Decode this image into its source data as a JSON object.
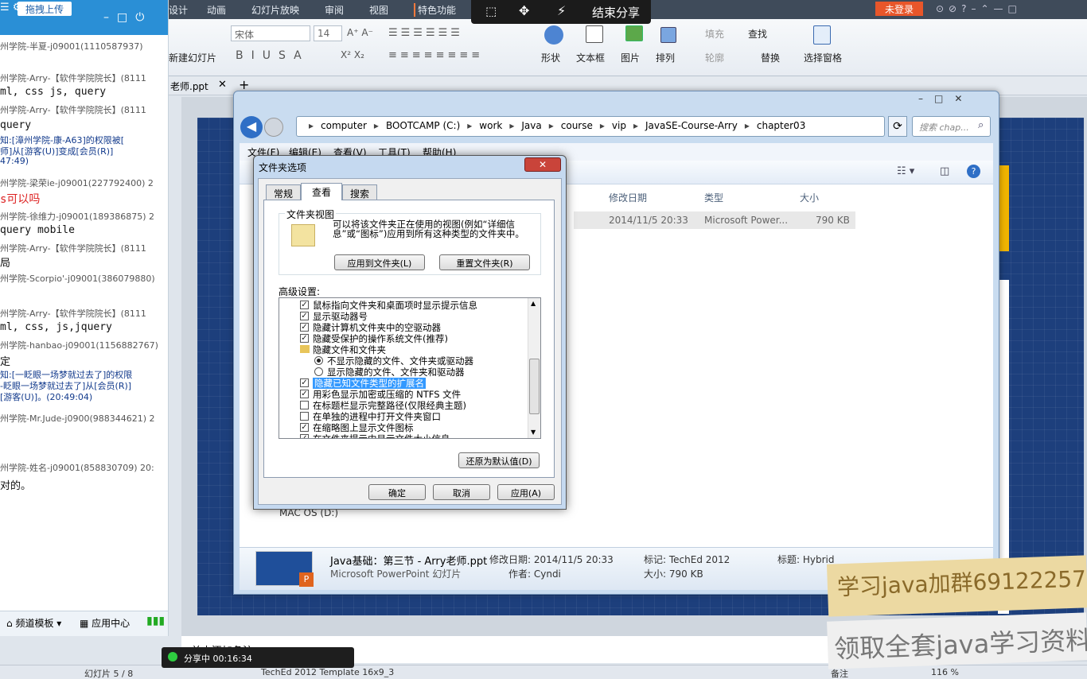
{
  "ppt": {
    "tabs": [
      "设计",
      "动画",
      "幻灯片放映",
      "审阅",
      "视图",
      "特色功能"
    ],
    "login": "未登录",
    "font_name": "宋体",
    "font_size": "14",
    "new_slide": "新建幻灯片",
    "shape": "形状",
    "textbox": "文本框",
    "picture": "图片",
    "arrange": "排列",
    "fill": "填充",
    "outline": "轮廓",
    "find": "查找",
    "replace": "替换",
    "select_pane": "选择窗格",
    "doc_tab": "老师.ppt",
    "notes": "单击添加备注",
    "status_slide": "幻灯片 5 / 8",
    "status_template": "TechEd 2012 Template 16x9_3",
    "status_notes": "备注",
    "status_zoom": "116 %"
  },
  "share_toolbar": {
    "end": "结束分享"
  },
  "chat": {
    "header": "拖拽上传",
    "messages": [
      {
        "kind": "line",
        "text": "州学院-半夏-j09001(1110587937)"
      },
      {
        "kind": "line",
        "text": "州学院-Arry-【软件学院院长】(8111"
      },
      {
        "kind": "msg",
        "text": "ml, css js, query"
      },
      {
        "kind": "line",
        "text": "州学院-Arry-【软件学院院长】(8111"
      },
      {
        "kind": "msg",
        "text": "query"
      },
      {
        "kind": "sys",
        "text": "知:[漳州学院-康-A63]的权限被["
      },
      {
        "kind": "sys",
        "text": "师]从[游客(U)]变成[会员(R)]"
      },
      {
        "kind": "sys",
        "text": "47:49)"
      },
      {
        "kind": "line",
        "text": "州学院-梁荣ie-j09001(227792400) 2"
      },
      {
        "kind": "red",
        "text": "s可以吗"
      },
      {
        "kind": "line",
        "text": "州学院-徐维力-j09001(189386875) 2"
      },
      {
        "kind": "msg",
        "text": "query mobile"
      },
      {
        "kind": "line",
        "text": "州学院-Arry-【软件学院院长】(8111"
      },
      {
        "kind": "msg",
        "text": "局"
      },
      {
        "kind": "line",
        "text": "州学院-Scorpio'-j09001(386079880)"
      },
      {
        "kind": "line",
        "text": "州学院-Arry-【软件学院院长】(8111"
      },
      {
        "kind": "msg",
        "text": "ml, css, js,jquery"
      },
      {
        "kind": "line",
        "text": "州学院-hanbao-j09001(1156882767)"
      },
      {
        "kind": "msg",
        "text": "定"
      },
      {
        "kind": "sys",
        "text": "知:[一眨眼一场梦就过去了]的权限"
      },
      {
        "kind": "sys",
        "text": "-眨眼一场梦就过去了]从[会员(R)]"
      },
      {
        "kind": "sys",
        "text": "[游客(U)]。(20:49:04)"
      },
      {
        "kind": "line",
        "text": "州学院-Mr.Jude-j0900(988344621) 2"
      },
      {
        "kind": "line",
        "text": "州学院-姓名-j09001(858830709) 20:"
      },
      {
        "kind": "msg",
        "text": "对的。"
      }
    ],
    "footer_channel": "频道模板",
    "footer_app": "应用中心",
    "share_status": "分享中 00:16:34"
  },
  "explorer": {
    "path": [
      "computer",
      "BOOTCAMP (C:)",
      "work",
      "Java",
      "course",
      "vip",
      "JavaSE-Course-Arry",
      "chapter03"
    ],
    "search_placeholder": "搜索 chap...",
    "menu": [
      "文件(F)",
      "编辑(E)",
      "查看(V)",
      "工具(T)",
      "帮助(H)"
    ],
    "columns": {
      "date": "修改日期",
      "type": "类型",
      "size": "大小"
    },
    "row": {
      "date": "2014/11/5 20:33",
      "type": "Microsoft Power...",
      "size": "790 KB"
    },
    "drive": "MAC OS (D:)",
    "details": {
      "name": "Java基础：第三节 - Arry老师.ppt",
      "type": "Microsoft PowerPoint 幻灯片",
      "modified_label": "修改日期: 2014/11/5 20:33",
      "author_label": "作者: Cyndi",
      "tags_label": "标记: TechEd 2012",
      "size_label": "大小: 790 KB",
      "title_label": "标题: Hybrid"
    }
  },
  "folder_options": {
    "title": "文件夹选项",
    "tabs": [
      "常规",
      "查看",
      "搜索"
    ],
    "folder_views_label": "文件夹视图",
    "folder_views_desc": "可以将该文件夹正在使用的视图(例如“详细信息”或“图标”)应用到所有这种类型的文件夹中。",
    "apply_to_folders": "应用到文件夹(L)",
    "reset_folders": "重置文件夹(R)",
    "advanced_label": "高级设置:",
    "items": [
      {
        "type": "check",
        "checked": true,
        "label": "鼠标指向文件夹和桌面项时显示提示信息"
      },
      {
        "type": "check",
        "checked": true,
        "label": "显示驱动器号"
      },
      {
        "type": "check",
        "checked": true,
        "label": "隐藏计算机文件夹中的空驱动器"
      },
      {
        "type": "check",
        "checked": true,
        "label": "隐藏受保护的操作系统文件(推荐)"
      },
      {
        "type": "folder",
        "label": "隐藏文件和文件夹"
      },
      {
        "type": "radio",
        "checked": true,
        "label": "不显示隐藏的文件、文件夹或驱动器"
      },
      {
        "type": "radio",
        "checked": false,
        "label": "显示隐藏的文件、文件夹和驱动器"
      },
      {
        "type": "check",
        "checked": true,
        "label": "隐藏已知文件类型的扩展名",
        "selected": true
      },
      {
        "type": "check",
        "checked": true,
        "label": "用彩色显示加密或压缩的 NTFS 文件"
      },
      {
        "type": "check",
        "checked": false,
        "label": "在标题栏显示完整路径(仅限经典主题)"
      },
      {
        "type": "check",
        "checked": false,
        "label": "在单独的进程中打开文件夹窗口"
      },
      {
        "type": "check",
        "checked": true,
        "label": "在缩略图上显示文件图标"
      },
      {
        "type": "check",
        "checked": true,
        "label": "在文件夹提示中显示文件大小信息"
      }
    ],
    "restore_defaults": "还原为默认值(D)",
    "ok": "确定",
    "cancel": "取消",
    "apply": "应用(A)"
  },
  "watermark": {
    "line1": "学习java加群691222579",
    "line2": "领取全套java学习资料"
  }
}
